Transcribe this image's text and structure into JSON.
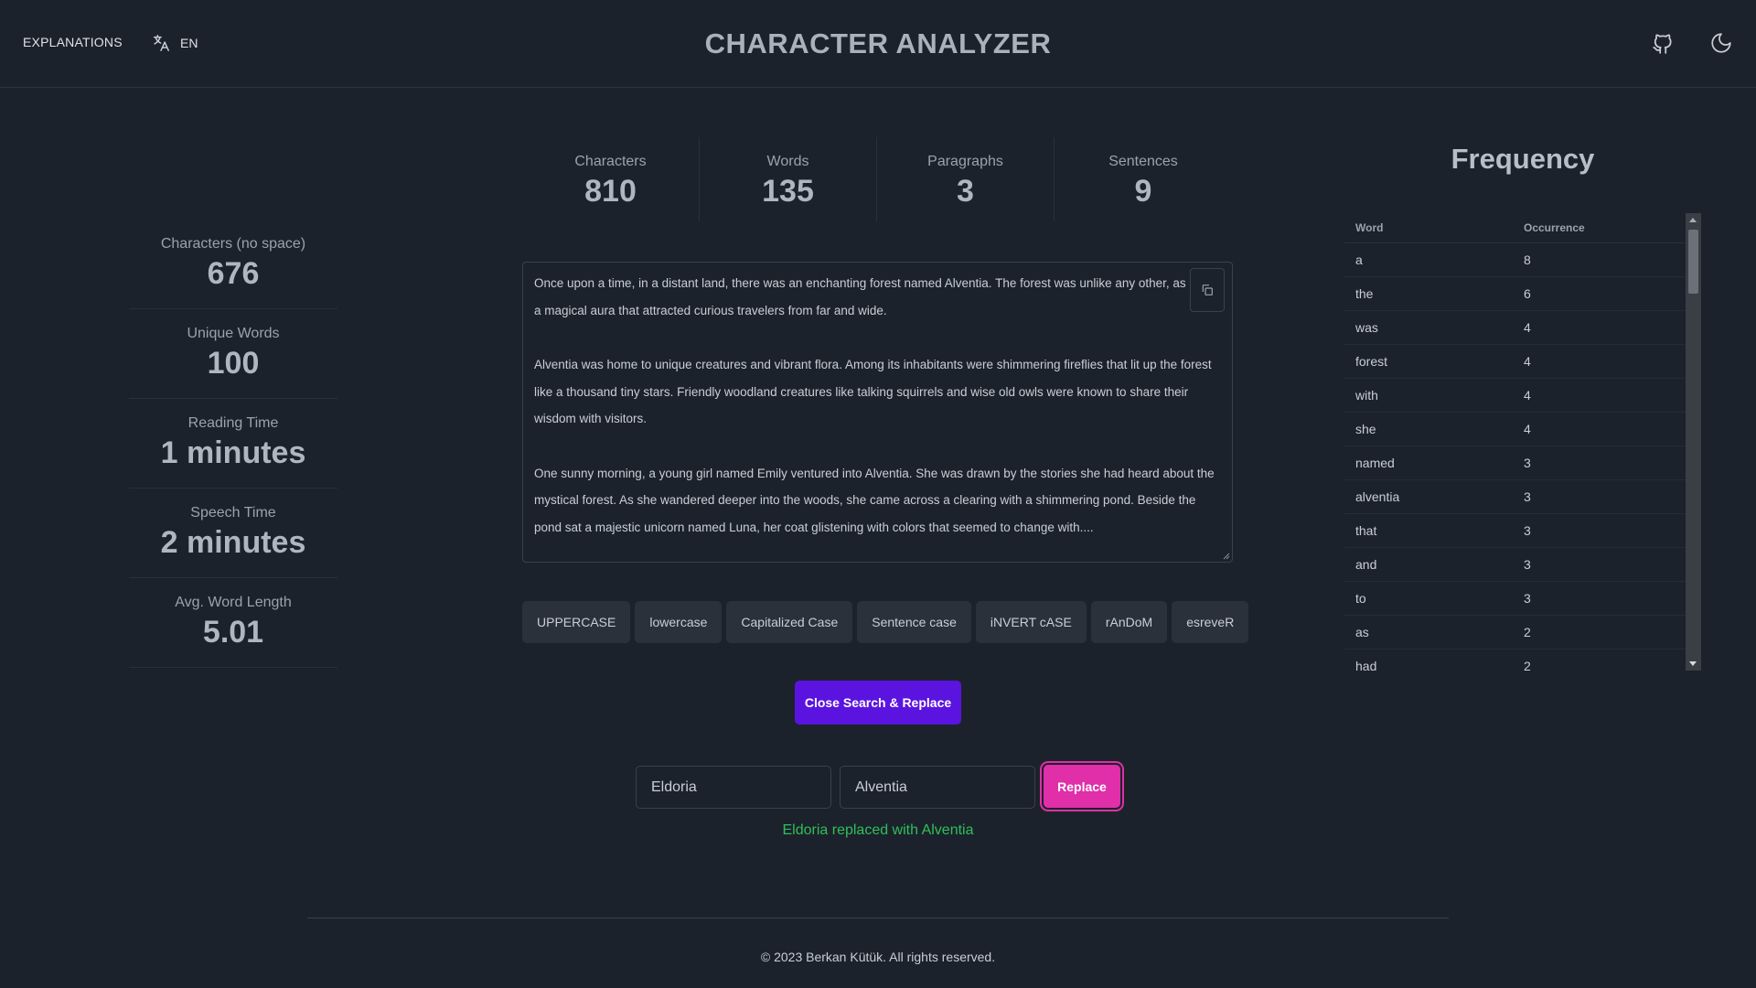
{
  "header": {
    "explanations_label": "EXPLANATIONS",
    "lang_label": "EN",
    "title": "CHARACTER ANALYZER",
    "github_icon": "github-icon",
    "theme_icon": "moon-icon"
  },
  "left_stats": [
    {
      "label": "Characters (no space)",
      "value": "676"
    },
    {
      "label": "Unique Words",
      "value": "100"
    },
    {
      "label": "Reading Time",
      "value": "1 minutes"
    },
    {
      "label": "Speech Time",
      "value": "2 minutes"
    },
    {
      "label": "Avg. Word Length",
      "value": "5.01"
    }
  ],
  "top_stats": [
    {
      "label": "Characters",
      "value": "810"
    },
    {
      "label": "Words",
      "value": "135"
    },
    {
      "label": "Paragraphs",
      "value": "3"
    },
    {
      "label": "Sentences",
      "value": "9"
    }
  ],
  "editor": {
    "paragraphs": [
      "Once upon a time, in a distant land, there was an enchanting forest named Alventia. The forest was unlike any other, as it had a magical aura that attracted curious travelers from far and wide.",
      "Alventia was home to unique creatures and vibrant flora. Among its inhabitants were shimmering fireflies that lit up the forest like a thousand tiny stars. Friendly woodland creatures like talking squirrels and wise old owls were known to share their wisdom with visitors.",
      "One sunny morning, a young girl named Emily ventured into Alventia. She was drawn by the stories she had heard about the mystical forest. As she wandered deeper into the woods, she came across a clearing with a shimmering pond. Beside the pond sat a majestic unicorn named Luna, her coat glistening with colors that seemed to change with...."
    ],
    "copy_icon": "copy-icon"
  },
  "case_buttons": [
    "UPPERCASE",
    "lowercase",
    "Capitalized Case",
    "Sentence case",
    "iNVERT cASE",
    "rAnDoM",
    "esreveR"
  ],
  "search_replace": {
    "toggle_label": "Close Search & Replace",
    "search_value": "Eldoria",
    "replace_value": "Alventia",
    "replace_label": "Replace",
    "status": "Eldoria replaced with Alventia"
  },
  "frequency": {
    "title": "Frequency",
    "columns": [
      "Word",
      "Occurrence"
    ],
    "rows": [
      [
        "a",
        "8"
      ],
      [
        "the",
        "6"
      ],
      [
        "was",
        "4"
      ],
      [
        "forest",
        "4"
      ],
      [
        "with",
        "4"
      ],
      [
        "she",
        "4"
      ],
      [
        "named",
        "3"
      ],
      [
        "alventia",
        "3"
      ],
      [
        "that",
        "3"
      ],
      [
        "and",
        "3"
      ],
      [
        "to",
        "3"
      ],
      [
        "as",
        "2"
      ],
      [
        "had",
        "2"
      ]
    ]
  },
  "footer": {
    "text": "© 2023 Berkan Kütük. All rights reserved."
  },
  "colors": {
    "primary": "#5b14e0",
    "accent": "#e02fa8",
    "success": "#2fbf5a",
    "background": "#1c222b"
  }
}
